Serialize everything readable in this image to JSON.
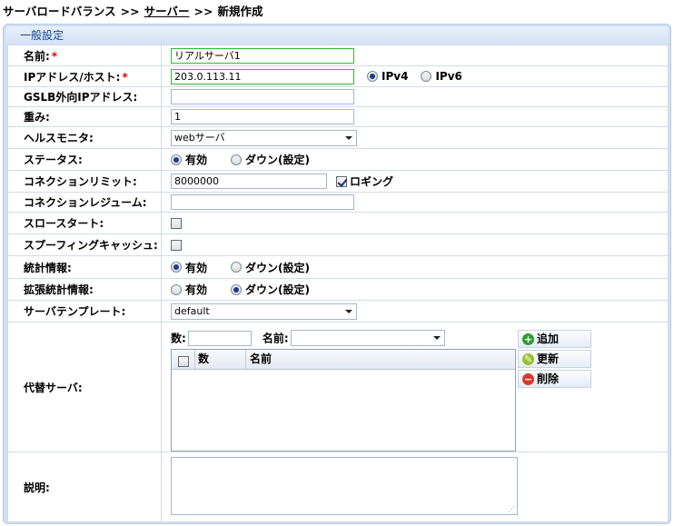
{
  "breadcrumb": {
    "root": "サーバロードバランス",
    "sep1": ">>",
    "link": "サーバー",
    "sep2": ">>",
    "current": "新規作成"
  },
  "panel": {
    "title": "一般設定"
  },
  "fields": {
    "name": {
      "label": "名前:",
      "required": "*",
      "value": "リアルサーバ1"
    },
    "ip": {
      "label": "IPアドレス/ホスト:",
      "required": "*",
      "value": "203.0.113.11",
      "opt_v4": "IPv4",
      "opt_v6": "IPv6",
      "selected": "IPv4"
    },
    "gslb": {
      "label": "GSLB外向IPアドレス:",
      "value": ""
    },
    "weight": {
      "label": "重み:",
      "value": "1"
    },
    "health": {
      "label": "ヘルスモニタ:",
      "value": "webサーバ"
    },
    "status": {
      "label": "ステータス:",
      "opt_on": "有効",
      "opt_off": "ダウン(設定)",
      "selected": "有効"
    },
    "conn_limit": {
      "label": "コネクションリミット:",
      "value": "8000000",
      "logging_label": "ロギング",
      "logging_checked": true
    },
    "conn_resume": {
      "label": "コネクションレジューム:",
      "value": ""
    },
    "slow_start": {
      "label": "スロースタート:",
      "checked": false
    },
    "spoofing": {
      "label": "スプーフィングキャッシュ:",
      "checked": false
    },
    "stats": {
      "label": "統計情報:",
      "opt_on": "有効",
      "opt_off": "ダウン(設定)",
      "selected": "有効"
    },
    "ext_stats": {
      "label": "拡張統計情報:",
      "opt_on": "有効",
      "opt_off": "ダウン(設定)",
      "selected": "ダウン(設定)"
    },
    "template": {
      "label": "サーバテンプレート:",
      "value": "default"
    },
    "alt": {
      "label": "代替サーバ:",
      "num_label": "数:",
      "num_value": "",
      "name_label": "名前:",
      "name_value": "",
      "col_num": "数",
      "col_name": "名前",
      "btn_add": "追加",
      "btn_update": "更新",
      "btn_delete": "削除"
    },
    "desc": {
      "label": "説明:",
      "value": ""
    }
  },
  "colors": {
    "panel_bg": "#cfdff3",
    "header_text": "#15428b",
    "required": "#dd0000",
    "valid_border": "#3ab53a"
  }
}
